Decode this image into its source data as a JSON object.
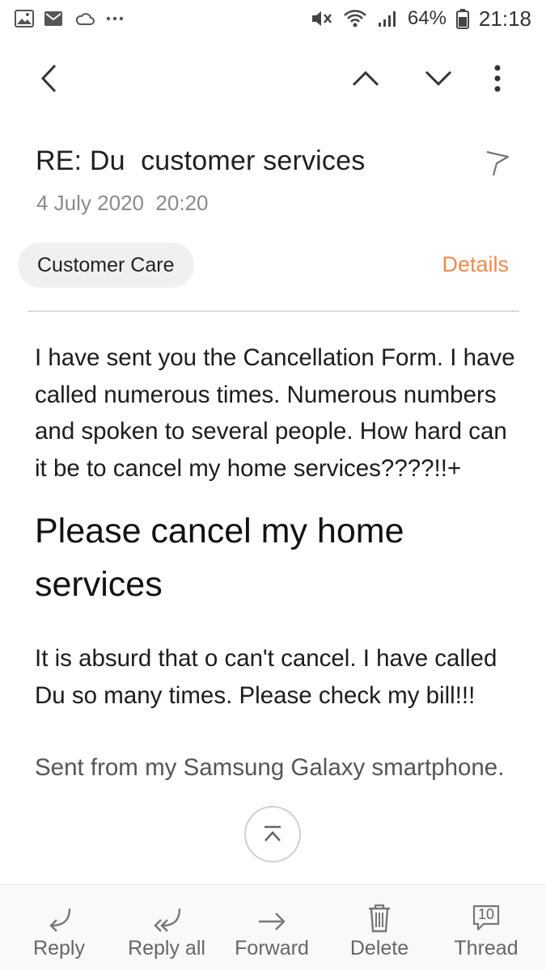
{
  "status_bar": {
    "battery": "64%",
    "time": "21:18",
    "icons": [
      "gallery-icon",
      "email-notification-icon",
      "cloud-sync-icon",
      "more-notifications-icon",
      "mute-icon",
      "wifi-icon",
      "signal-icon",
      "battery-icon"
    ]
  },
  "toolbar": {
    "icons": [
      "back-icon",
      "previous-email-icon",
      "next-email-icon",
      "more-options-icon"
    ]
  },
  "email": {
    "subject": "RE: Du  customer services",
    "date": "4 July 2020  20:20",
    "sender": "Customer Care",
    "details_label": "Details",
    "body": {
      "paragraph1": "I have sent you the Cancellation Form.  I have called numerous times. Numerous numbers and spoken to several people. How hard can it be to cancel my home services????!!+",
      "heading": "Please cancel my home services",
      "paragraph2": "It is absurd that o can't cancel. I have called Du so many times. Please check my bill!!!",
      "signature": "Sent from my Samsung Galaxy smartphone."
    }
  },
  "bottom_actions": {
    "reply": "Reply",
    "reply_all": "Reply all",
    "forward": "Forward",
    "delete": "Delete",
    "thread": "Thread",
    "thread_count": "10"
  },
  "colors": {
    "accent": "#f08a4b",
    "chip_bg": "#f0f0f0",
    "muted_text": "#8a8a8a"
  }
}
